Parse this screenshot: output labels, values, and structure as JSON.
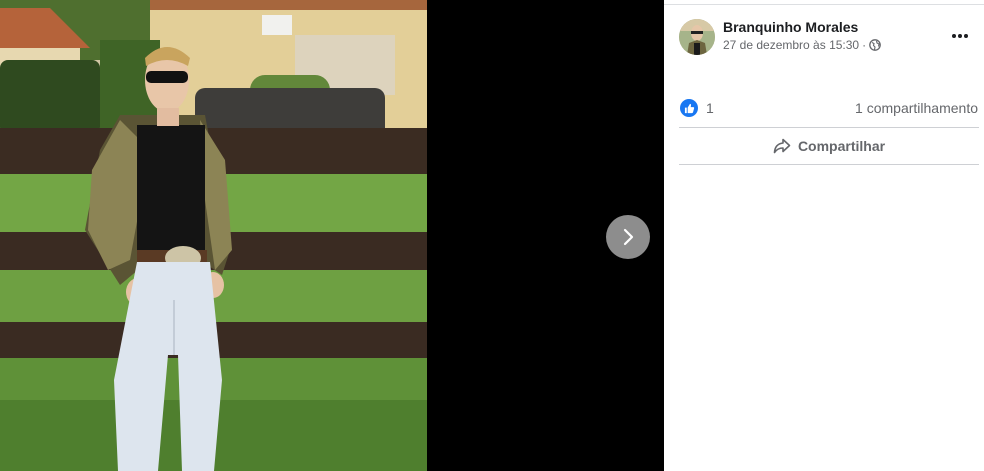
{
  "post": {
    "author": "Branquinho Morales",
    "date": "27 de dezembro às 15:30",
    "separator": "·",
    "audience_icon": "globe-icon"
  },
  "reactions": {
    "icon": "like-icon",
    "count": "1",
    "shares": "1 compartilhamento"
  },
  "actions": {
    "share_label": "Compartilhar",
    "share_icon": "share-arrow-icon"
  },
  "viewer": {
    "next_icon": "chevron-right-icon",
    "more_icon": "more-options-icon"
  },
  "colors": {
    "accent": "#1877f2",
    "secondary_text": "#65676b",
    "primary_text": "#1c1e21"
  }
}
